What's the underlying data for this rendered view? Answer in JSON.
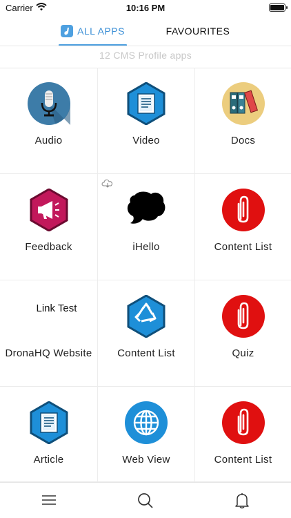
{
  "status": {
    "carrier": "Carrier",
    "time": "10:16 PM"
  },
  "tabs": {
    "all_apps": "ALL APPS",
    "favourites": "FAVOURITES"
  },
  "summary": "12 CMS Profile apps",
  "apps": [
    {
      "label": "Audio",
      "icon": "microphone-icon"
    },
    {
      "label": "Video",
      "icon": "document-hexagon-icon"
    },
    {
      "label": "Docs",
      "icon": "binders-icon"
    },
    {
      "label": "Feedback",
      "icon": "megaphone-icon"
    },
    {
      "label": "iHello",
      "icon": "speech-bubble-icon"
    },
    {
      "label": "Content List",
      "icon": "paperclip-icon"
    },
    {
      "label": "DronaHQ Website",
      "icon": "link-test-icon",
      "icon_text": "Link Test"
    },
    {
      "label": "Content List",
      "icon": "recycle-icon"
    },
    {
      "label": "Quiz",
      "icon": "paperclip-icon"
    },
    {
      "label": "Article",
      "icon": "document-hexagon-icon"
    },
    {
      "label": "Web View",
      "icon": "globe-icon"
    },
    {
      "label": "Content List",
      "icon": "paperclip-icon"
    }
  ],
  "colors": {
    "accent": "#4ea0e0",
    "paperclip_red": "#e01010",
    "hex_blue": "#1e8fd8",
    "hex_magenta": "#c2185b"
  }
}
